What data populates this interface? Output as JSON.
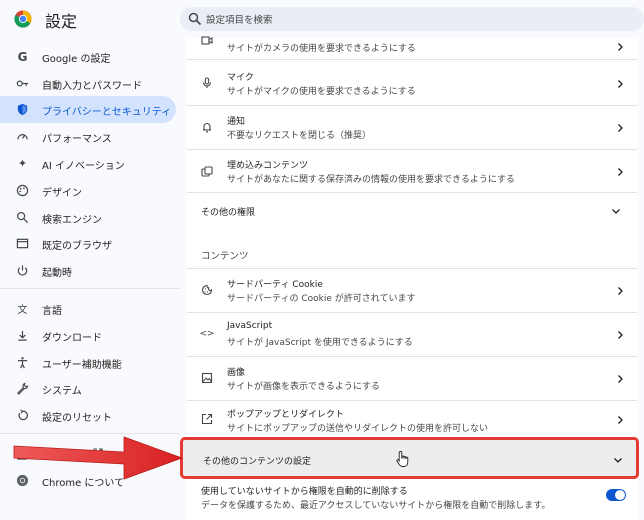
{
  "header": {
    "title": "設定",
    "search_placeholder": "設定項目を検索"
  },
  "sidebar": {
    "items": [
      {
        "label": "Google の設定",
        "icon": "google-g-icon"
      },
      {
        "label": "自動入力とパスワード",
        "icon": "key-icon"
      },
      {
        "label": "プライバシーとセキュリティ",
        "icon": "shield-icon",
        "active": true
      },
      {
        "label": "パフォーマンス",
        "icon": "speedometer-icon"
      },
      {
        "label": "AI イノベーション",
        "icon": "sparkle-icon"
      },
      {
        "label": "デザイン",
        "icon": "palette-icon"
      },
      {
        "label": "検索エンジン",
        "icon": "search-icon"
      },
      {
        "label": "既定のブラウザ",
        "icon": "browser-window-icon"
      },
      {
        "label": "起動時",
        "icon": "power-icon"
      },
      {
        "label": "言語",
        "icon": "translate-icon"
      },
      {
        "label": "ダウンロード",
        "icon": "download-icon"
      },
      {
        "label": "ユーザー補助機能",
        "icon": "accessibility-icon"
      },
      {
        "label": "システム",
        "icon": "wrench-icon"
      },
      {
        "label": "設定のリセット",
        "icon": "reset-icon"
      },
      {
        "label": "拡張機能",
        "icon": "puzzle-icon"
      },
      {
        "label": "Chrome について",
        "icon": "chrome-icon"
      }
    ]
  },
  "main": {
    "camera_sub": "サイトがカメラの使用を要求できるようにする",
    "rows": [
      {
        "title": "マイク",
        "sub": "サイトがマイクの使用を要求できるようにする",
        "icon": "microphone-icon"
      },
      {
        "title": "通知",
        "sub": "不要なリクエストを閉じる（推奨）",
        "icon": "bell-icon"
      },
      {
        "title": "埋め込みコンテンツ",
        "sub": "サイトがあなたに関する保存済みの情報の使用を要求できるようにする",
        "icon": "embedded-content-icon"
      }
    ],
    "other_permissions": "その他の権限",
    "content_section_label": "コンテンツ",
    "content_rows": [
      {
        "title": "サードパーティ Cookie",
        "sub": "サードパーティの Cookie が許可されています",
        "icon": "cookie-icon"
      },
      {
        "title": "JavaScript",
        "sub": "サイトが JavaScript を使用できるようにする",
        "icon": "code-icon"
      },
      {
        "title": "画像",
        "sub": "サイトが画像を表示できるようにする",
        "icon": "image-icon"
      },
      {
        "title": "ポップアップとリダイレクト",
        "sub": "サイトにポップアップの送信やリダイレクトの使用を許可しない",
        "icon": "popup-icon"
      }
    ],
    "more_content_settings": "その他のコンテンツの設定",
    "auto_revoke": {
      "title": "使用していないサイトから権限を自動的に削除する",
      "sub": "データを保護するため、最近アクセスしていないサイトから権限を自動で削除します。",
      "enabled": true
    }
  },
  "colors": {
    "accent": "#0b57d0",
    "active_nav_bg": "#d3e3fd",
    "annotation_red": "#e53935"
  }
}
